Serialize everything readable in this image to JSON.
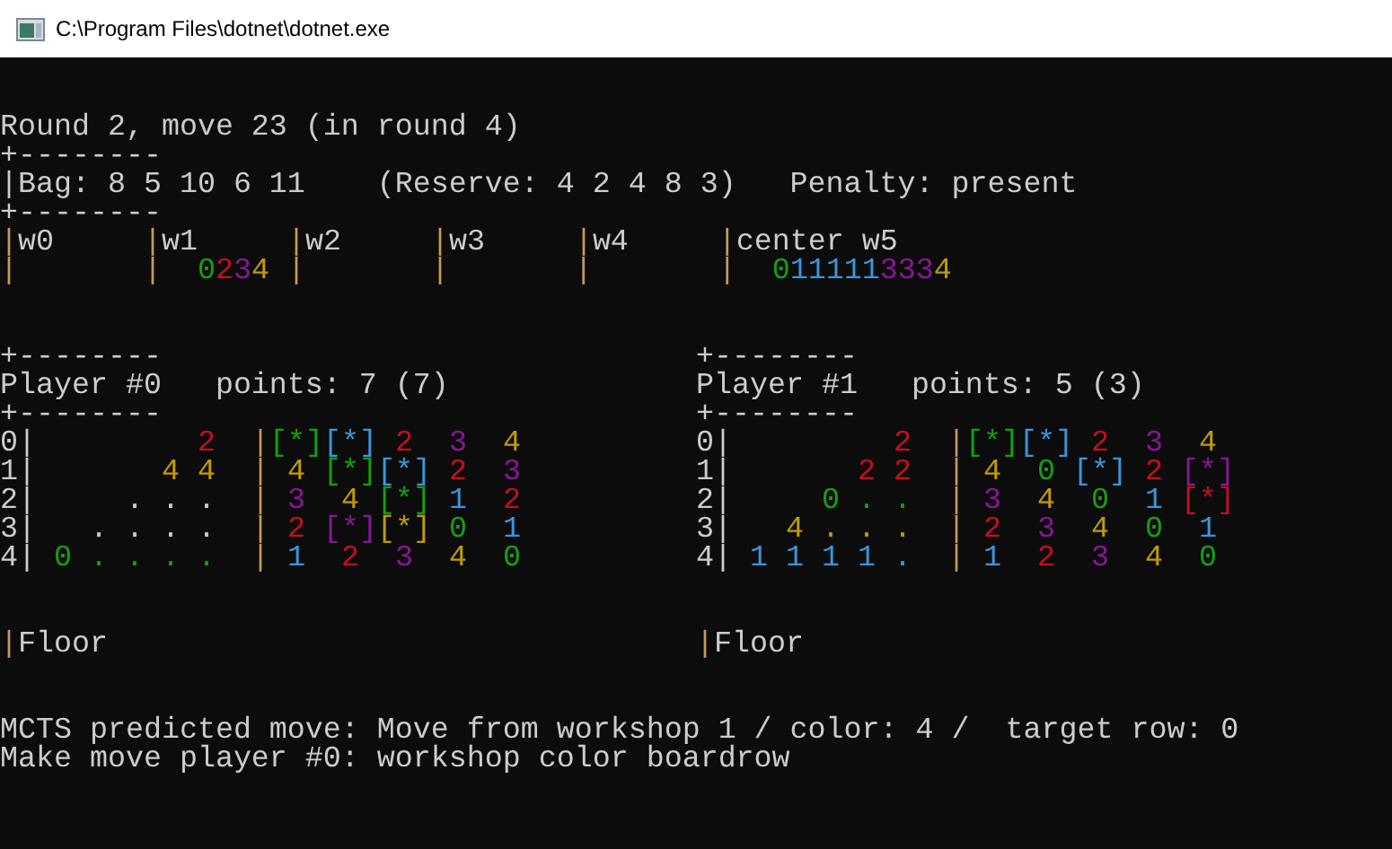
{
  "window": {
    "title": "C:\\Program Files\\dotnet\\dotnet.exe"
  },
  "header_lines": [
    {
      "segments": [
        {
          "text": "Round 2, move 23 (in round 4)"
        }
      ]
    },
    {
      "segments": [
        {
          "text": "+--------"
        }
      ]
    },
    {
      "segments": [
        {
          "text": "|Bag: 8 5 10 6 11    (Reserve: 4 2 4 8 3)   Penalty: present"
        }
      ]
    },
    {
      "segments": [
        {
          "text": "+--------"
        }
      ]
    },
    {
      "segments": [
        {
          "text": "|",
          "color": "#c29a5b"
        },
        {
          "text": "w0     "
        },
        {
          "text": "|",
          "color": "#c29a5b"
        },
        {
          "text": "w1     "
        },
        {
          "text": "|",
          "color": "#c29a5b"
        },
        {
          "text": "w2     "
        },
        {
          "text": "|",
          "color": "#c29a5b"
        },
        {
          "text": "w3     "
        },
        {
          "text": "|",
          "color": "#c29a5b"
        },
        {
          "text": "w4     "
        },
        {
          "text": "|",
          "color": "#c29a5b"
        },
        {
          "text": "center w5"
        }
      ]
    },
    {
      "segments": [
        {
          "text": "|",
          "color": "#c29a5b"
        },
        {
          "text": "       |",
          "color": "#c29a5b"
        },
        {
          "text": "  0",
          "color": "#13a10e"
        },
        {
          "text": "2",
          "color": "#c50f1f"
        },
        {
          "text": "3",
          "color": "#881798"
        },
        {
          "text": "4",
          "color": "#c19c00"
        },
        {
          "text": " |",
          "color": "#c29a5b"
        },
        {
          "text": "       |",
          "color": "#c29a5b"
        },
        {
          "text": "       |",
          "color": "#c29a5b"
        },
        {
          "text": "       |",
          "color": "#c29a5b"
        },
        {
          "text": "  0",
          "color": "#13a10e"
        },
        {
          "text": "11111",
          "color": "#3a96dd"
        },
        {
          "text": "333",
          "color": "#881798"
        },
        {
          "text": "4",
          "color": "#c19c00"
        }
      ]
    }
  ],
  "players": [
    {
      "lines": [
        {
          "segments": [
            {
              "text": "+--------"
            }
          ]
        },
        {
          "segments": [
            {
              "text": "Player #0   points: 7 (7)"
            }
          ]
        },
        {
          "segments": [
            {
              "text": "+--------"
            }
          ]
        },
        {
          "segments": [
            {
              "text": "0|"
            },
            {
              "text": "         2",
              "color": "#c50f1f"
            },
            {
              "text": "  |",
              "color": "#c29a5b"
            },
            {
              "text": "[*]",
              "color": "#13a10e"
            },
            {
              "text": "[*]",
              "color": "#3a96dd"
            },
            {
              "text": " 2 ",
              "color": "#c50f1f"
            },
            {
              "text": " 3 ",
              "color": "#881798"
            },
            {
              "text": " 4 ",
              "color": "#c19c00"
            }
          ]
        },
        {
          "segments": [
            {
              "text": "1|"
            },
            {
              "text": "       4 4",
              "color": "#c19c00"
            },
            {
              "text": "  |",
              "color": "#c29a5b"
            },
            {
              "text": " 4 ",
              "color": "#c19c00"
            },
            {
              "text": "[*]",
              "color": "#13a10e"
            },
            {
              "text": "[*]",
              "color": "#3a96dd"
            },
            {
              "text": " 2 ",
              "color": "#c50f1f"
            },
            {
              "text": " 3 ",
              "color": "#881798"
            }
          ]
        },
        {
          "segments": [
            {
              "text": "2|"
            },
            {
              "text": "     . . ."
            },
            {
              "text": "  |",
              "color": "#c29a5b"
            },
            {
              "text": " 3 ",
              "color": "#881798"
            },
            {
              "text": " 4 ",
              "color": "#c19c00"
            },
            {
              "text": "[*]",
              "color": "#13a10e"
            },
            {
              "text": " 1 ",
              "color": "#3a96dd"
            },
            {
              "text": " 2 ",
              "color": "#c50f1f"
            }
          ]
        },
        {
          "segments": [
            {
              "text": "3|"
            },
            {
              "text": "   . . . ."
            },
            {
              "text": "  |",
              "color": "#c29a5b"
            },
            {
              "text": " 2 ",
              "color": "#c50f1f"
            },
            {
              "text": "[*]",
              "color": "#881798"
            },
            {
              "text": "[*]",
              "color": "#c19c00"
            },
            {
              "text": " 0 ",
              "color": "#13a10e"
            },
            {
              "text": " 1 ",
              "color": "#3a96dd"
            }
          ]
        },
        {
          "segments": [
            {
              "text": "4|"
            },
            {
              "text": " 0 . . . .",
              "color": "#13a10e"
            },
            {
              "text": "  |",
              "color": "#c29a5b"
            },
            {
              "text": " 1 ",
              "color": "#3a96dd"
            },
            {
              "text": " 2 ",
              "color": "#c50f1f"
            },
            {
              "text": " 3 ",
              "color": "#881798"
            },
            {
              "text": " 4 ",
              "color": "#c19c00"
            },
            {
              "text": " 0 ",
              "color": "#13a10e"
            }
          ]
        }
      ],
      "floor": {
        "segments": [
          {
            "text": "|",
            "color": "#c29a5b"
          },
          {
            "text": "Floor"
          }
        ]
      }
    },
    {
      "lines": [
        {
          "segments": [
            {
              "text": "+--------"
            }
          ]
        },
        {
          "segments": [
            {
              "text": "Player #1   points: 5 (3)"
            }
          ]
        },
        {
          "segments": [
            {
              "text": "+--------"
            }
          ]
        },
        {
          "segments": [
            {
              "text": "0|"
            },
            {
              "text": "         2",
              "color": "#c50f1f"
            },
            {
              "text": "  |",
              "color": "#c29a5b"
            },
            {
              "text": "[*]",
              "color": "#13a10e"
            },
            {
              "text": "[*]",
              "color": "#3a96dd"
            },
            {
              "text": " 2 ",
              "color": "#c50f1f"
            },
            {
              "text": " 3 ",
              "color": "#881798"
            },
            {
              "text": " 4 ",
              "color": "#c19c00"
            }
          ]
        },
        {
          "segments": [
            {
              "text": "1|"
            },
            {
              "text": "       2 2",
              "color": "#c50f1f"
            },
            {
              "text": "  |",
              "color": "#c29a5b"
            },
            {
              "text": " 4 ",
              "color": "#c19c00"
            },
            {
              "text": " 0 ",
              "color": "#13a10e"
            },
            {
              "text": "[*]",
              "color": "#3a96dd"
            },
            {
              "text": " 2 ",
              "color": "#c50f1f"
            },
            {
              "text": "[*]",
              "color": "#881798"
            }
          ]
        },
        {
          "segments": [
            {
              "text": "2|"
            },
            {
              "text": "     0 . .",
              "color": "#13a10e"
            },
            {
              "text": "  |",
              "color": "#c29a5b"
            },
            {
              "text": " 3 ",
              "color": "#881798"
            },
            {
              "text": " 4 ",
              "color": "#c19c00"
            },
            {
              "text": " 0 ",
              "color": "#13a10e"
            },
            {
              "text": " 1 ",
              "color": "#3a96dd"
            },
            {
              "text": "[*]",
              "color": "#c50f1f"
            }
          ]
        },
        {
          "segments": [
            {
              "text": "3|"
            },
            {
              "text": "   4 . . .",
              "color": "#c19c00"
            },
            {
              "text": "  |",
              "color": "#c29a5b"
            },
            {
              "text": " 2 ",
              "color": "#c50f1f"
            },
            {
              "text": " 3 ",
              "color": "#881798"
            },
            {
              "text": " 4 ",
              "color": "#c19c00"
            },
            {
              "text": " 0 ",
              "color": "#13a10e"
            },
            {
              "text": " 1 ",
              "color": "#3a96dd"
            }
          ]
        },
        {
          "segments": [
            {
              "text": "4|"
            },
            {
              "text": " 1 1 1 1 .",
              "color": "#3a96dd"
            },
            {
              "text": "  |",
              "color": "#c29a5b"
            },
            {
              "text": " 1 ",
              "color": "#3a96dd"
            },
            {
              "text": " 2 ",
              "color": "#c50f1f"
            },
            {
              "text": " 3 ",
              "color": "#881798"
            },
            {
              "text": " 4 ",
              "color": "#c19c00"
            },
            {
              "text": " 0 ",
              "color": "#13a10e"
            }
          ]
        }
      ],
      "floor": {
        "segments": [
          {
            "text": "|",
            "color": "#c29a5b"
          },
          {
            "text": "Floor"
          }
        ]
      }
    }
  ],
  "footer_lines": [
    {
      "segments": [
        {
          "text": "MCTS predicted move: Move from workshop 1 / color: 4 /  target row: 0"
        }
      ]
    },
    {
      "segments": [
        {
          "text": "Make move player #0: workshop color boardrow"
        }
      ]
    }
  ]
}
